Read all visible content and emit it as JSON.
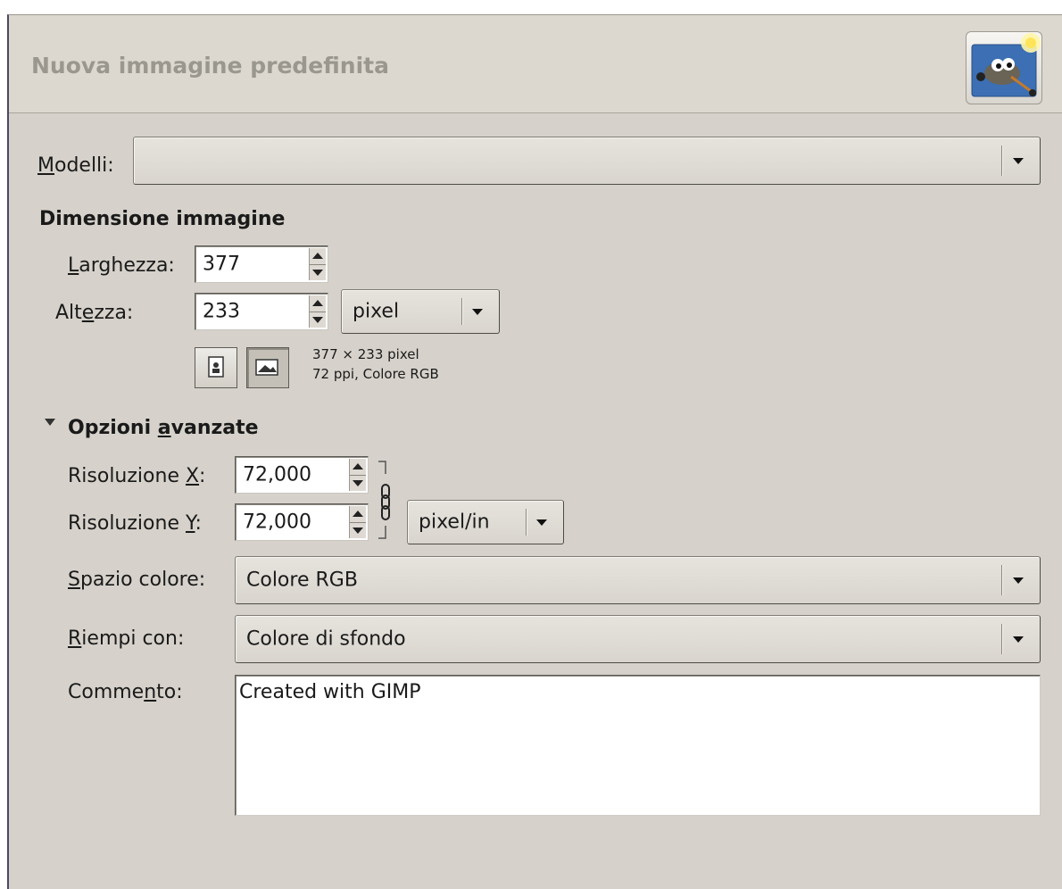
{
  "header": {
    "title": "Nuova immagine predefinita",
    "icon": "gimp-wilber-icon"
  },
  "templates": {
    "label_pre": "",
    "label_mnemonic": "M",
    "label_post": "odelli:",
    "value": ""
  },
  "image_size": {
    "title": "Dimensione immagine",
    "width": {
      "label_pre": "",
      "label_mnemonic": "L",
      "label_post": "arghezza:",
      "value": "377"
    },
    "height": {
      "label_pre": "Alt",
      "label_mnemonic": "e",
      "label_post": "zza:",
      "value": "233"
    },
    "unit": "pixel",
    "info_line1": "377 × 233 pixel",
    "info_line2": "72 ppi, Colore RGB",
    "portrait_icon": "portrait-icon",
    "landscape_icon": "landscape-icon"
  },
  "advanced": {
    "title_pre": "Opzioni ",
    "title_mnemonic": "a",
    "title_post": "vanzate",
    "xres": {
      "label_pre": "Risoluzione ",
      "label_mnemonic": "X",
      "label_post": ":",
      "value": "72,000"
    },
    "yres": {
      "label_pre": "Risoluzione ",
      "label_mnemonic": "Y",
      "label_post": ":",
      "value": "72,000"
    },
    "res_unit": "pixel/in",
    "colorspace": {
      "label_pre": "",
      "label_mnemonic": "S",
      "label_post": "pazio colore:",
      "value": "Colore RGB"
    },
    "fill": {
      "label_pre": "",
      "label_mnemonic": "R",
      "label_post": "iempi con:",
      "value": "Colore di sfondo"
    },
    "comment": {
      "label_pre": "Comme",
      "label_mnemonic": "n",
      "label_post": "to:",
      "value": "Created with GIMP"
    }
  }
}
